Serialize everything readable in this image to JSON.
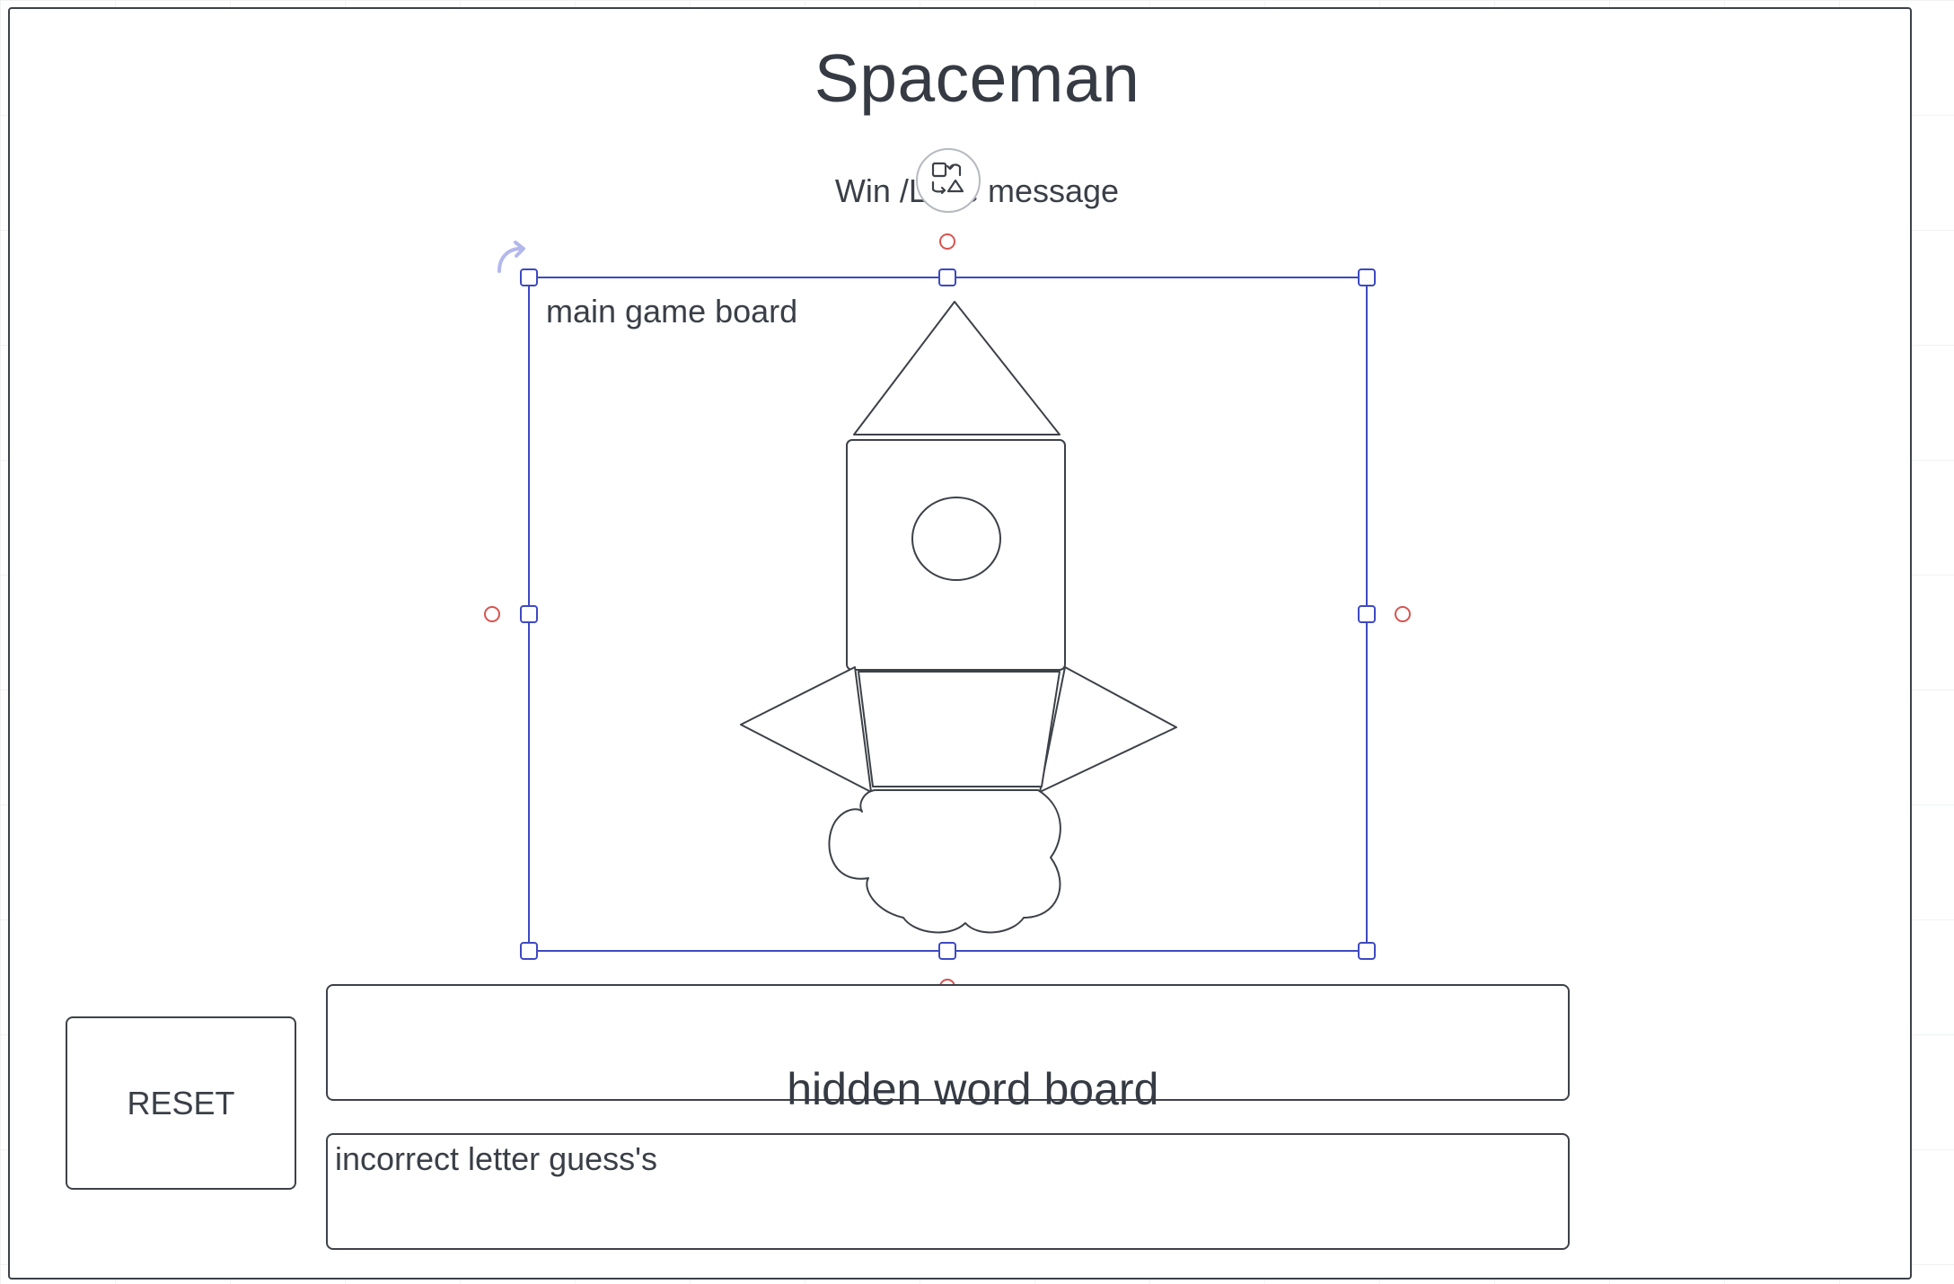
{
  "canvas": {
    "title": "Spaceman",
    "win_lose_message": "Win /Lose message"
  },
  "game_board": {
    "label": "main game board"
  },
  "hidden_word_board": {
    "label": "hidden word board",
    "blanks": "_ _ _ _ _ _ _ _"
  },
  "incorrect_board": {
    "label": "incorrect letter guess's"
  },
  "reset_button": {
    "label": "RESET"
  },
  "colors": {
    "selection": "#3d4ac2",
    "connection_point": "#d9534f",
    "stroke": "#3d4148",
    "text": "#3a3f47"
  },
  "icons": {
    "quick_actions": "shape-swap-icon",
    "rotate": "rotate-arrow-icon"
  }
}
